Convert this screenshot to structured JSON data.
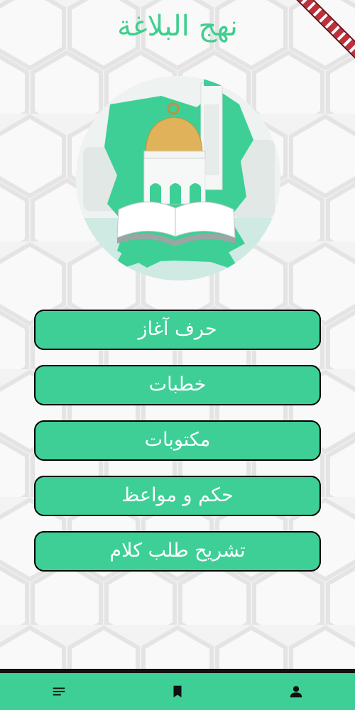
{
  "app": {
    "title": "نهج البلاغة",
    "accent_color": "#3ecf96"
  },
  "menu": {
    "items": [
      {
        "label": "حرف آغاز"
      },
      {
        "label": "خطبات"
      },
      {
        "label": "مكتوبات"
      },
      {
        "label": "حكم و مواعظ"
      },
      {
        "label": "تشریح طلب کلام"
      }
    ]
  },
  "bottom_nav": {
    "items": [
      {
        "icon": "menu-lines-icon"
      },
      {
        "icon": "bookmark-icon"
      },
      {
        "icon": "person-icon"
      }
    ]
  }
}
